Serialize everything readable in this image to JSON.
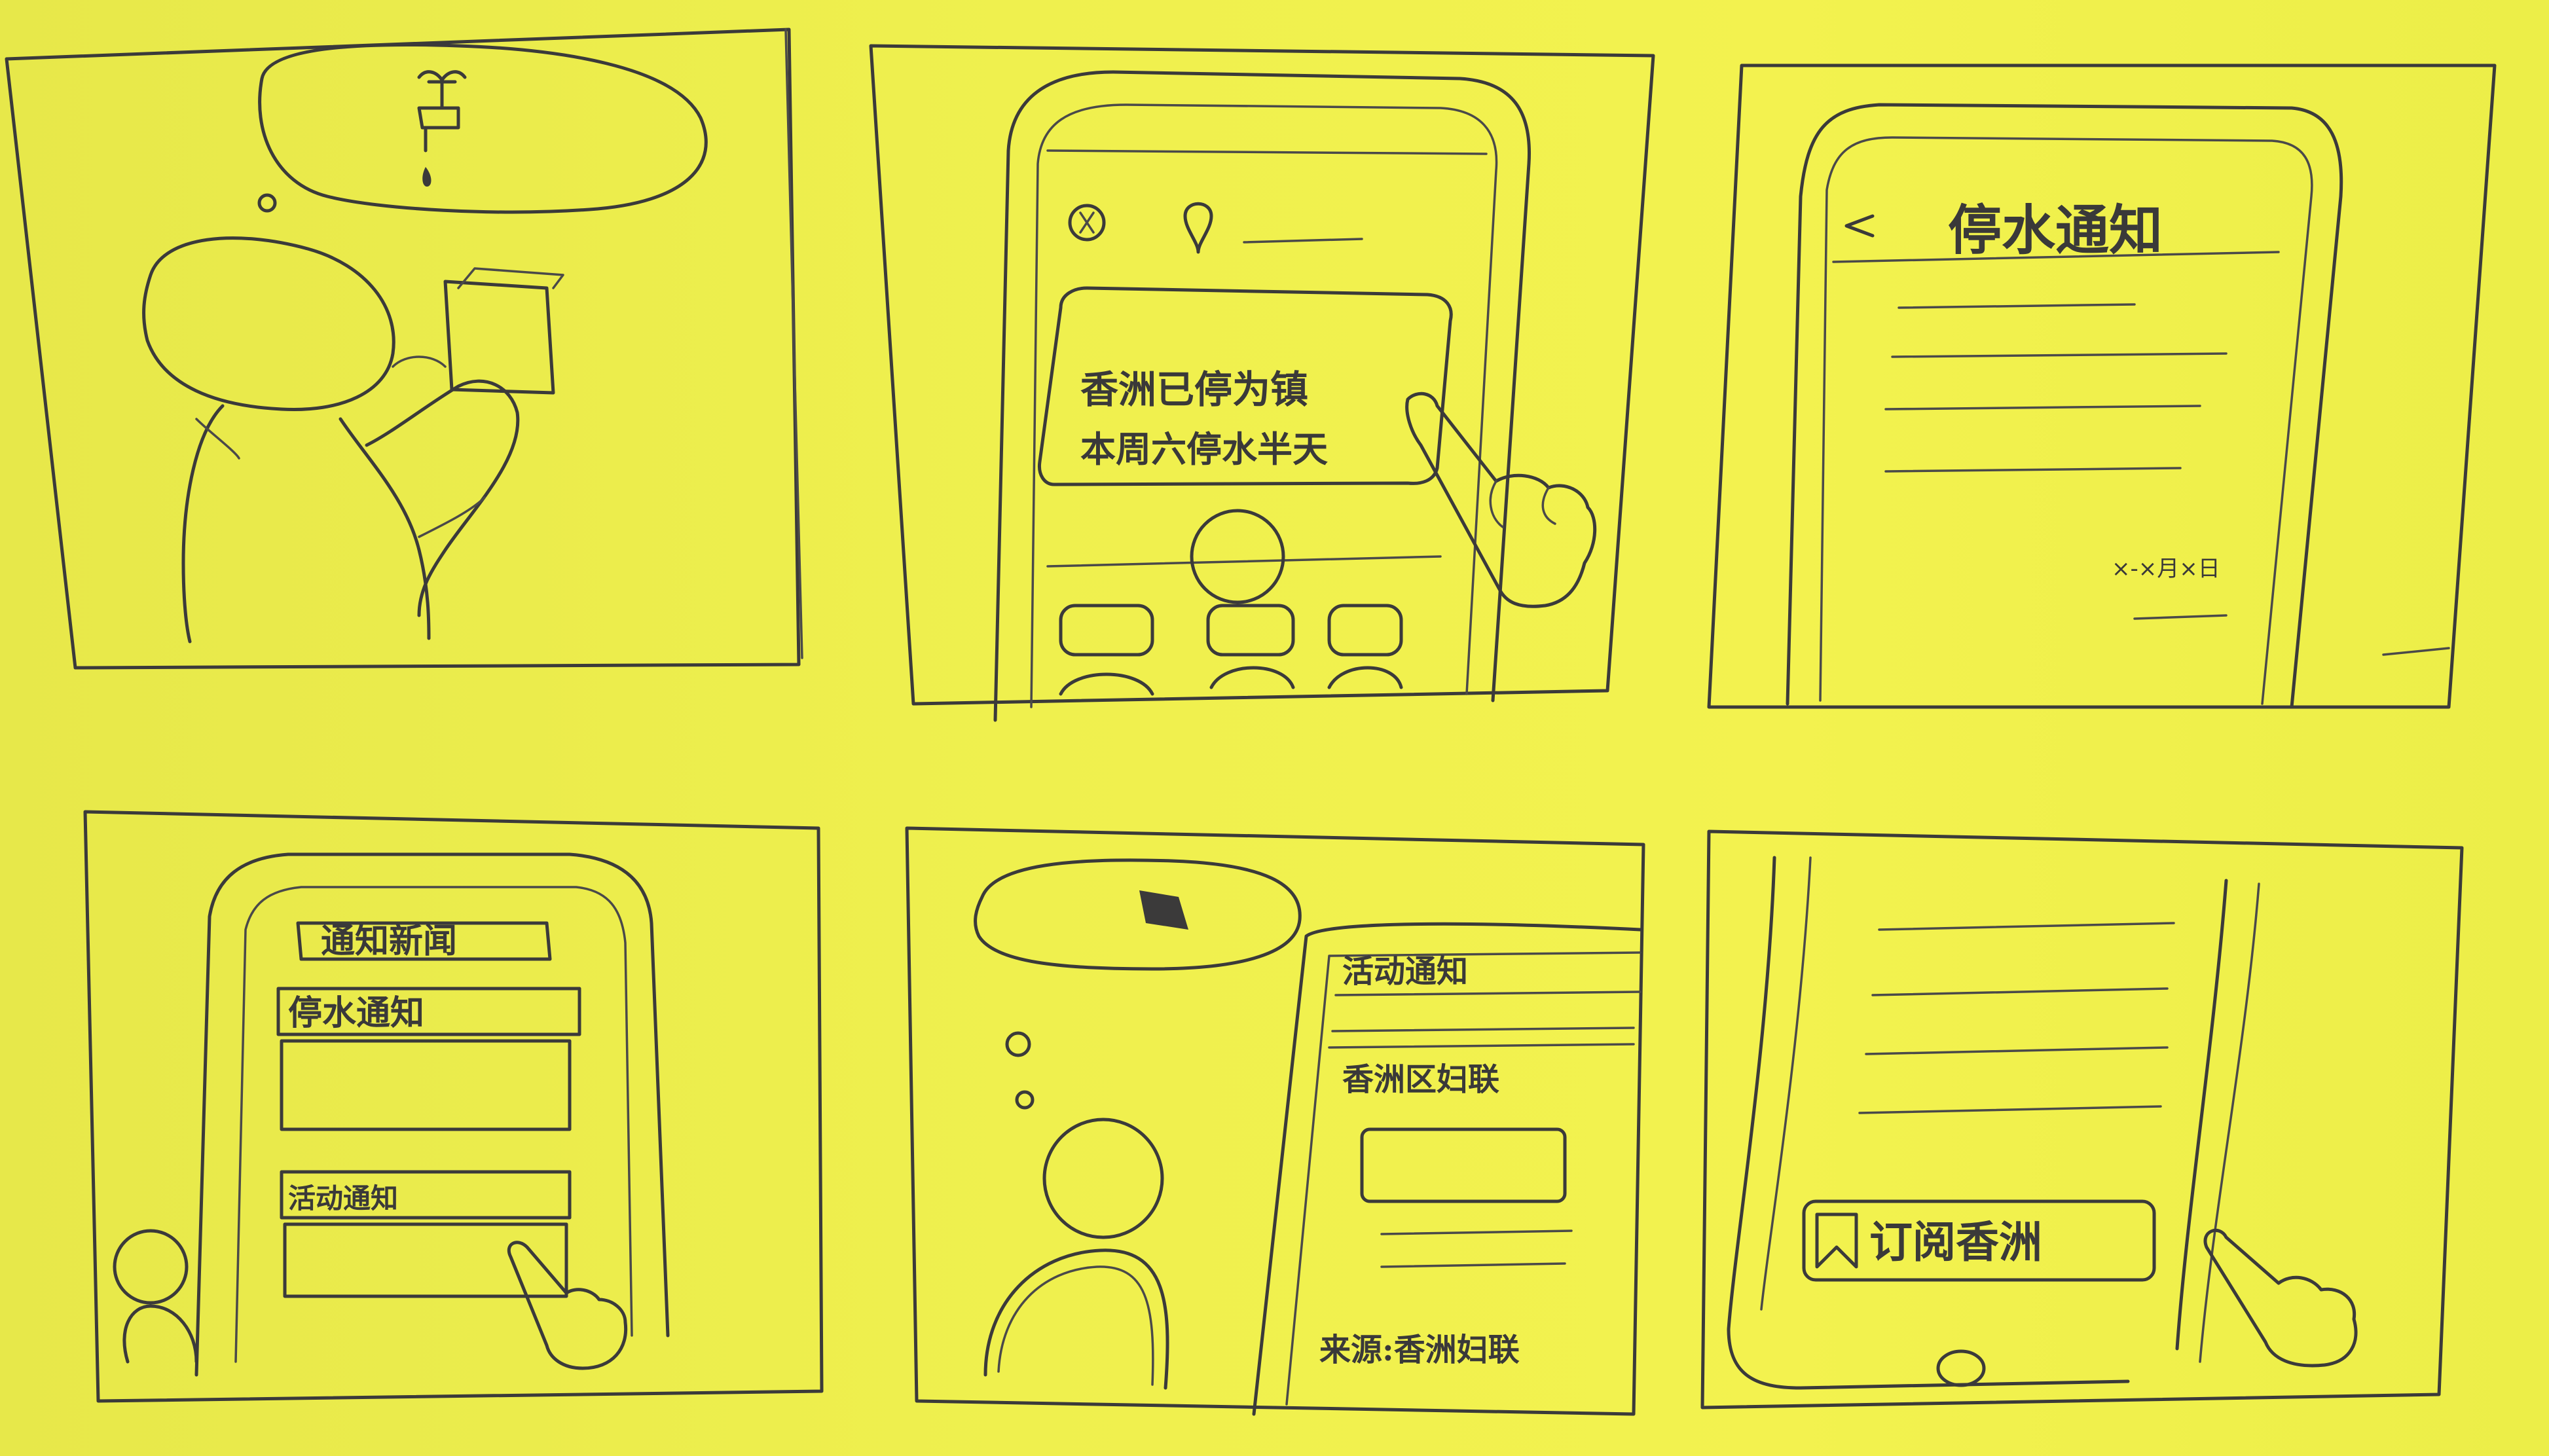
{
  "panels": [
    {
      "id": 1,
      "scene": "person-with-phone-thinking-of-tap"
    },
    {
      "id": 2,
      "screen_text_line1": "香洲已停为镇",
      "screen_text_line2": "本周六停水半天"
    },
    {
      "id": 3,
      "title": "停水通知",
      "date": "×-×月×日"
    },
    {
      "id": 4,
      "header": "通知新闻",
      "item1": "停水通知",
      "item2": "活动通知"
    },
    {
      "id": 5,
      "item1": "活动通知",
      "item2": "香洲区妇联",
      "footer": "来源:香洲妇联"
    },
    {
      "id": 6,
      "subscribe_label": "订阅香洲"
    }
  ],
  "paper_color": "#eeef4c",
  "ink_color": "#3b3a3a"
}
